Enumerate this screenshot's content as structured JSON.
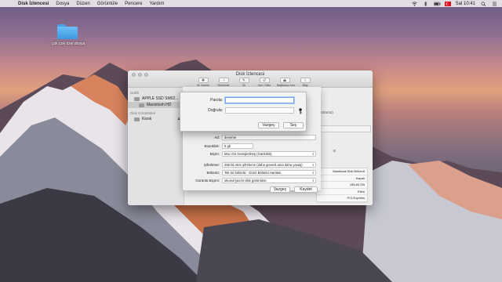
{
  "menubar": {
    "app_name": "Disk İzlencesi",
    "menus": [
      "Dosya",
      "Düzen",
      "Görüntüle",
      "Pencere",
      "Yardım"
    ],
    "clock": "Sal 10:41"
  },
  "desktop": {
    "folder_label": "çok çok özel dosya"
  },
  "window": {
    "title": "Disk İzlencesi",
    "toolbar": [
      {
        "label": "İlk Yardım",
        "icon": "first-aid-icon"
      },
      {
        "label": "Bölüntüle",
        "icon": "partition-icon"
      },
      {
        "label": "Sil",
        "icon": "erase-icon"
      },
      {
        "label": "Geri Yükle",
        "icon": "restore-icon"
      },
      {
        "label": "Bağlantıyı Kes",
        "icon": "unmount-icon"
      },
      {
        "label": "Bilgi",
        "icon": "info-icon"
      }
    ]
  },
  "sidebar": {
    "section_internal": "Dahili",
    "disk_name": "APPLE SSD SM02...",
    "volume_name": "Macintosh HD",
    "section_images": "Disk Görüntüleri",
    "image_name": "Kiosk"
  },
  "behind": {
    "partial_1": "Görüntü)",
    "partial_2": "B",
    "table": [
      "Mantıksal Disk Bölümü",
      "Kapalı",
      "156,84 GB",
      "Etkin",
      "PCI-Express"
    ]
  },
  "sheet": {
    "name_label": "Ad:",
    "name_value": "deneme",
    "size_label": "Büyüklük:",
    "size_value": "5 gb",
    "format_label": "Biçim:",
    "format_value": "Mac OS Genişletilmiş (Günlüklü)",
    "encryption_label": "Şifreleme:",
    "encryption_value": "256 bit AES şifreleme (daha güvenli ama daha yavaş)",
    "partitions_label": "Bölüntü:",
    "partitions_value": "Tek bir bölüntü - GUID Bölüntü Haritası",
    "image_format_label": "Görüntü Biçimi:",
    "image_format_value": "okunur/yazılır disk görüntüsü",
    "cancel": "Vazgeç",
    "save": "Kaydet"
  },
  "password": {
    "password_label": "Parola:",
    "verify_label": "Doğrula:",
    "password_value": "",
    "verify_value": "",
    "cancel": "Vazgeç",
    "choose": "Seç"
  }
}
